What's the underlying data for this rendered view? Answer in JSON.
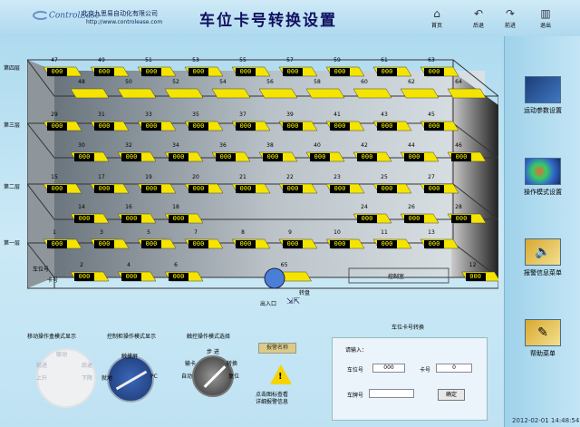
{
  "header": {
    "logo_text": "ControlEase",
    "company": "北京九思易自动化有限公司",
    "url": "http://www.controlease.com",
    "title": "车位卡号转换设置"
  },
  "nav": [
    {
      "label": "首页",
      "icon": "home-icon"
    },
    {
      "label": "后退",
      "icon": "back-icon"
    },
    {
      "label": "前进",
      "icon": "forward-icon"
    },
    {
      "label": "退出",
      "icon": "exit-icon"
    }
  ],
  "floors": [
    "第四层",
    "第三层",
    "第二层",
    "第一层"
  ],
  "row_labels": {
    "car_no": "车位号",
    "card_no": "卡号"
  },
  "slots": {
    "f4_back": [
      "47",
      "49",
      "51",
      "53",
      "55",
      "57",
      "59",
      "61",
      "63"
    ],
    "f4_front": [
      "48",
      "50",
      "52",
      "54",
      "56",
      "58",
      "60",
      "62",
      "64"
    ],
    "f3_back": [
      "29",
      "31",
      "33",
      "35",
      "37",
      "39",
      "41",
      "43",
      "45"
    ],
    "f3_front": [
      "30",
      "32",
      "34",
      "36",
      "38",
      "40",
      "42",
      "44",
      "46"
    ],
    "f2_back": [
      "15",
      "17",
      "19",
      "20",
      "21",
      "22",
      "23",
      "25",
      "27"
    ],
    "f2_front": [
      "14",
      "16",
      "18",
      "24",
      "26",
      "28"
    ],
    "f1_back": [
      "1",
      "3",
      "5",
      "7",
      "8",
      "9",
      "10",
      "11",
      "13"
    ],
    "f1_front": [
      "2",
      "4",
      "6",
      "65",
      "12"
    ]
  },
  "card_value": "000",
  "control_room": "控制室",
  "turntable": "转盘",
  "entrance": "出入口",
  "colors": {
    "slot_fill": "#f5e400",
    "card_bg": "#000000",
    "card_text": "#ffee00",
    "turntable": "#4a7fd8"
  },
  "right_panel": [
    {
      "label": "运动参数设置",
      "icon": "motion-params-icon"
    },
    {
      "label": "操作模式设置",
      "icon": "operation-mode-icon"
    },
    {
      "label": "报警信息菜单",
      "icon": "alarm-menu-icon"
    },
    {
      "label": "帮助菜单",
      "icon": "help-menu-icon"
    }
  ],
  "bottom": {
    "mobile_title": "移动操作盒模式显示",
    "mobile_labels": [
      "联动",
      "前进",
      "后退",
      "上升",
      "下降"
    ],
    "control_title": "控制柜操作模式显示",
    "control_labels": [
      "触摸屏",
      "就地",
      "PC"
    ],
    "touch_title": "触控操作模式选择",
    "touch_labels": [
      "步 进",
      "输卡",
      "转换",
      "自动",
      "复位"
    ],
    "alarm_name": "报警名称",
    "alarm_hint_1": "点击图标查看",
    "alarm_hint_2": "详细报警信息"
  },
  "conversion": {
    "title": "车位卡号转换",
    "subtitle": "请输入：",
    "car_no_label": "车位号",
    "car_no_value": "000",
    "card_no_label": "卡号",
    "card_no_value": "0",
    "plate_label": "车牌号",
    "plate_value": "",
    "confirm": "确定"
  },
  "timestamp": "2012-02-01  14:48:54"
}
